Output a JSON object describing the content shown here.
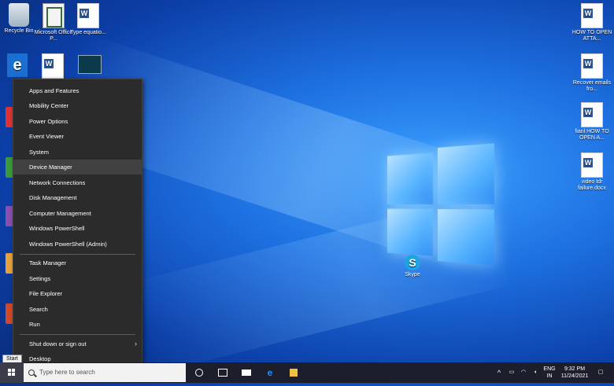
{
  "desktop": {
    "left_icons": [
      {
        "label": "Recycle Bin",
        "icon": "recycle-bin-icon"
      },
      {
        "label": "Microsoft Office P...",
        "icon": "office-icon"
      },
      {
        "label": "Type equatio...",
        "icon": "word-doc-icon"
      }
    ],
    "right_icons": [
      {
        "label": "HOW TO OPEN ATTA...",
        "icon": "word-doc-icon"
      },
      {
        "label": "Recover emails fro...",
        "icon": "word-doc-icon"
      },
      {
        "label": "fianl HOW TO OPEN A...",
        "icon": "word-doc-icon"
      },
      {
        "label": "video tdr failure.docx",
        "icon": "word-doc-icon"
      }
    ],
    "skype": {
      "label": "Skype",
      "icon": "skype-icon"
    }
  },
  "context_menu": {
    "group1": [
      "Apps and Features",
      "Mobility Center",
      "Power Options",
      "Event Viewer",
      "System",
      "Device Manager",
      "Network Connections",
      "Disk Management",
      "Computer Management",
      "Windows PowerShell",
      "Windows PowerShell (Admin)"
    ],
    "group2": [
      "Task Manager",
      "Settings",
      "File Explorer",
      "Search",
      "Run"
    ],
    "group3": [
      "Shut down or sign out",
      "Desktop"
    ],
    "highlighted": "Device Manager"
  },
  "start_tooltip": "Start",
  "taskbar": {
    "search_placeholder": "Type here to search",
    "pinned": [
      "cortana-icon",
      "task-view-icon",
      "mail-icon",
      "edge-icon",
      "store-icon"
    ],
    "tray": {
      "lang_line1": "ENG",
      "lang_line2": "IN",
      "time": "9:32 PM",
      "date": "11/24/2021"
    }
  },
  "colors": {
    "accent": "#1d6fe0",
    "menu_bg": "#2b2b2b",
    "taskbar_bg": "#1c1f2b"
  }
}
